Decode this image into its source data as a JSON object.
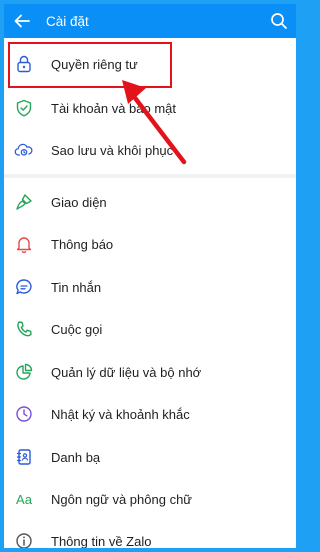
{
  "header": {
    "title": "Cài đặt",
    "back_icon": "arrow-left-icon",
    "search_icon": "search-icon",
    "background": "#0a8ff7"
  },
  "group_account": [
    {
      "label": "Quyền riêng tư",
      "icon": "lock-icon"
    },
    {
      "label": "Tài khoản và bảo mật",
      "icon": "shield-icon"
    },
    {
      "label": "Sao lưu và khôi phục",
      "icon": "cloud-sync-icon"
    }
  ],
  "group_settings": [
    {
      "label": "Giao diện",
      "icon": "paintbrush-icon"
    },
    {
      "label": "Thông báo",
      "icon": "bell-icon"
    },
    {
      "label": "Tin nhắn",
      "icon": "chat-bubble-icon"
    },
    {
      "label": "Cuộc gọi",
      "icon": "phone-icon"
    },
    {
      "label": "Quản lý dữ liệu và bộ nhớ",
      "icon": "pie-chart-icon"
    },
    {
      "label": "Nhật ký và khoảnh khắc",
      "icon": "clock-icon"
    },
    {
      "label": "Danh bạ",
      "icon": "contact-book-icon"
    },
    {
      "label": "Ngôn ngữ và phông chữ",
      "icon": "font-aa-icon",
      "glyph": "Aa"
    },
    {
      "label": "Thông tin về Zalo",
      "icon": "info-icon"
    }
  ],
  "annotation": {
    "highlight_color": "#e3131b"
  }
}
